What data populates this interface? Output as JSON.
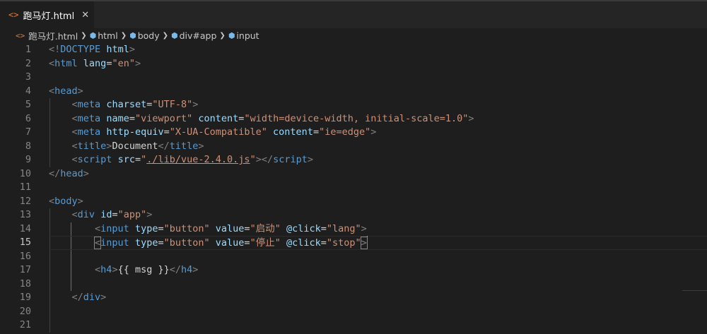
{
  "tab": {
    "icon": "<>",
    "label": "跑马灯.html",
    "close": "✕"
  },
  "breadcrumb": {
    "file_icon": "<>",
    "file": "跑马灯.html",
    "items": [
      "html",
      "body",
      "div#app",
      "input"
    ]
  },
  "editor": {
    "active_line": 15,
    "lines": [
      {
        "n": "1",
        "tokens": [
          [
            "b",
            "<!"
          ],
          [
            "tag",
            "DOCTYPE"
          ],
          [
            "t",
            " "
          ],
          [
            "attr",
            "html"
          ],
          [
            "b",
            ">"
          ]
        ]
      },
      {
        "n": "2",
        "tokens": [
          [
            "b",
            "<"
          ],
          [
            "tag",
            "html"
          ],
          [
            "t",
            " "
          ],
          [
            "attr",
            "lang"
          ],
          [
            "eq",
            "="
          ],
          [
            "str",
            "\"en\""
          ],
          [
            "b",
            ">"
          ]
        ]
      },
      {
        "n": "3",
        "tokens": []
      },
      {
        "n": "4",
        "tokens": [
          [
            "b",
            "<"
          ],
          [
            "tag",
            "head"
          ],
          [
            "b",
            ">"
          ]
        ]
      },
      {
        "n": "5",
        "tokens": [
          [
            "t",
            "    "
          ],
          [
            "b",
            "<"
          ],
          [
            "tag",
            "meta"
          ],
          [
            "t",
            " "
          ],
          [
            "attr",
            "charset"
          ],
          [
            "eq",
            "="
          ],
          [
            "str",
            "\"UTF-8\""
          ],
          [
            "b",
            ">"
          ]
        ]
      },
      {
        "n": "6",
        "tokens": [
          [
            "t",
            "    "
          ],
          [
            "b",
            "<"
          ],
          [
            "tag",
            "meta"
          ],
          [
            "t",
            " "
          ],
          [
            "attr",
            "name"
          ],
          [
            "eq",
            "="
          ],
          [
            "str",
            "\"viewport\""
          ],
          [
            "t",
            " "
          ],
          [
            "attr",
            "content"
          ],
          [
            "eq",
            "="
          ],
          [
            "str",
            "\"width=device-width, initial-scale=1.0\""
          ],
          [
            "b",
            ">"
          ]
        ]
      },
      {
        "n": "7",
        "tokens": [
          [
            "t",
            "    "
          ],
          [
            "b",
            "<"
          ],
          [
            "tag",
            "meta"
          ],
          [
            "t",
            " "
          ],
          [
            "attr",
            "http-equiv"
          ],
          [
            "eq",
            "="
          ],
          [
            "str",
            "\"X-UA-Compatible\""
          ],
          [
            "t",
            " "
          ],
          [
            "attr",
            "content"
          ],
          [
            "eq",
            "="
          ],
          [
            "str",
            "\"ie=edge\""
          ],
          [
            "b",
            ">"
          ]
        ]
      },
      {
        "n": "8",
        "tokens": [
          [
            "t",
            "    "
          ],
          [
            "b",
            "<"
          ],
          [
            "tag",
            "title"
          ],
          [
            "b",
            ">"
          ],
          [
            "t",
            "Document"
          ],
          [
            "b",
            "</"
          ],
          [
            "tag",
            "title"
          ],
          [
            "b",
            ">"
          ]
        ]
      },
      {
        "n": "9",
        "tokens": [
          [
            "t",
            "    "
          ],
          [
            "b",
            "<"
          ],
          [
            "tag",
            "script"
          ],
          [
            "t",
            " "
          ],
          [
            "attr",
            "src"
          ],
          [
            "eq",
            "="
          ],
          [
            "str",
            "\""
          ],
          [
            "link",
            "./lib/vue-2.4.0.js"
          ],
          [
            "str",
            "\""
          ],
          [
            "b",
            "></"
          ],
          [
            "tag",
            "script"
          ],
          [
            "b",
            ">"
          ]
        ]
      },
      {
        "n": "10",
        "tokens": [
          [
            "b",
            "</"
          ],
          [
            "tag",
            "head"
          ],
          [
            "b",
            ">"
          ]
        ]
      },
      {
        "n": "11",
        "tokens": []
      },
      {
        "n": "12",
        "tokens": [
          [
            "b",
            "<"
          ],
          [
            "tag",
            "body"
          ],
          [
            "b",
            ">"
          ]
        ]
      },
      {
        "n": "13",
        "tokens": [
          [
            "t",
            "    "
          ],
          [
            "b",
            "<"
          ],
          [
            "tag",
            "div"
          ],
          [
            "t",
            " "
          ],
          [
            "attr",
            "id"
          ],
          [
            "eq",
            "="
          ],
          [
            "str",
            "\"app\""
          ],
          [
            "b",
            ">"
          ]
        ]
      },
      {
        "n": "14",
        "tokens": [
          [
            "t",
            "        "
          ],
          [
            "b",
            "<"
          ],
          [
            "tag",
            "input"
          ],
          [
            "t",
            " "
          ],
          [
            "attr",
            "type"
          ],
          [
            "eq",
            "="
          ],
          [
            "str",
            "\"button\""
          ],
          [
            "t",
            " "
          ],
          [
            "attr",
            "value"
          ],
          [
            "eq",
            "="
          ],
          [
            "str",
            "\"启动\""
          ],
          [
            "t",
            " "
          ],
          [
            "attr",
            "@click"
          ],
          [
            "eq",
            "="
          ],
          [
            "str",
            "\"lang\""
          ],
          [
            "b",
            ">"
          ]
        ]
      },
      {
        "n": "15",
        "tokens": [
          [
            "t",
            "        "
          ],
          [
            "bb",
            "<"
          ],
          [
            "tag",
            "input"
          ],
          [
            "t",
            " "
          ],
          [
            "attr",
            "type"
          ],
          [
            "eq",
            "="
          ],
          [
            "str",
            "\"button\""
          ],
          [
            "t",
            " "
          ],
          [
            "attr",
            "value"
          ],
          [
            "eq",
            "="
          ],
          [
            "str",
            "\"停止\""
          ],
          [
            "t",
            " "
          ],
          [
            "attr",
            "@click"
          ],
          [
            "eq",
            "="
          ],
          [
            "str",
            "\"stop\""
          ],
          [
            "bb",
            ">"
          ]
        ]
      },
      {
        "n": "16",
        "tokens": []
      },
      {
        "n": "17",
        "tokens": [
          [
            "t",
            "        "
          ],
          [
            "b",
            "<"
          ],
          [
            "tag",
            "h4"
          ],
          [
            "b",
            ">"
          ],
          [
            "t",
            "{{ msg }}"
          ],
          [
            "b",
            "</"
          ],
          [
            "tag",
            "h4"
          ],
          [
            "b",
            ">"
          ]
        ]
      },
      {
        "n": "18",
        "tokens": []
      },
      {
        "n": "19",
        "tokens": [
          [
            "t",
            "    "
          ],
          [
            "b",
            "</"
          ],
          [
            "tag",
            "div"
          ],
          [
            "b",
            ">"
          ]
        ]
      },
      {
        "n": "20",
        "tokens": []
      },
      {
        "n": "21",
        "tokens": []
      }
    ]
  }
}
